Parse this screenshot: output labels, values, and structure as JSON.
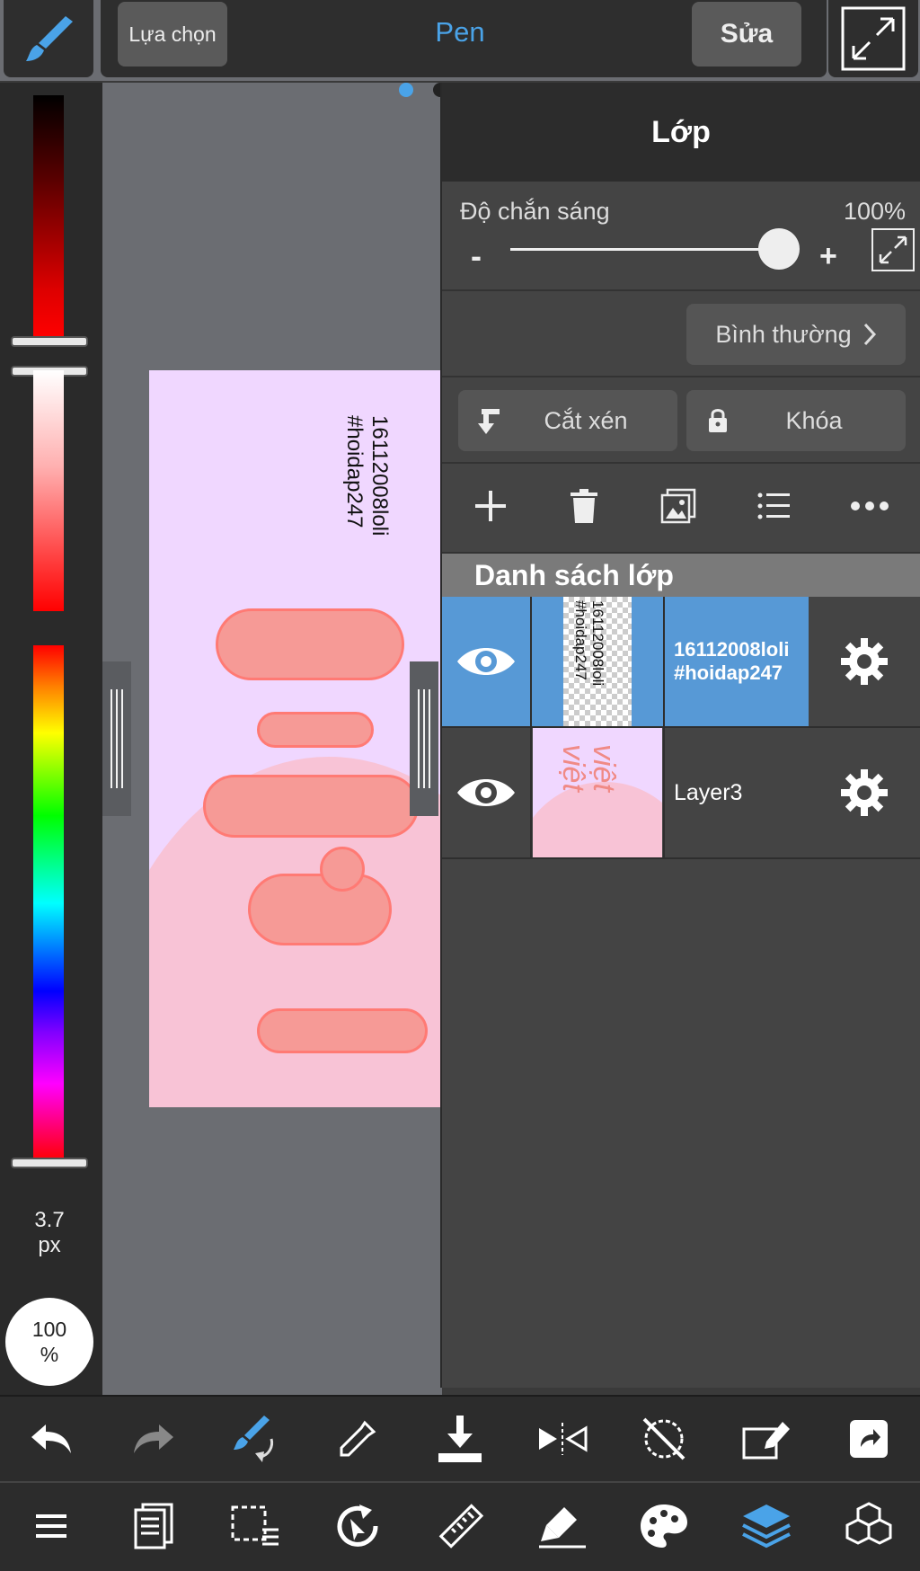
{
  "topbar": {
    "select_label": "Lựa chọn",
    "pen_title": "Pen",
    "edit_label": "Sửa"
  },
  "left_panel": {
    "brush_size_value": "3.7",
    "brush_size_unit": "px",
    "opacity_value": "100",
    "opacity_unit": "%"
  },
  "artwork": {
    "text_lines": "16112008loli\n#hoidap247"
  },
  "layer_panel": {
    "title": "Lớp",
    "opacity_label": "Độ chắn sáng",
    "opacity_value": "100%",
    "opacity_level": 1.0,
    "minus": "-",
    "plus": "+",
    "blend_mode": "Bình thường",
    "clip_label": "Cắt xén",
    "lock_label": "Khóa",
    "list_header": "Danh sách lớp",
    "layers": [
      {
        "name_line1": "16112008loli",
        "name_line2": "#hoidap247",
        "thumb_text": "16112008loli\n#hoidap247",
        "selected": true
      },
      {
        "name": "Layer3",
        "thumb_text": "việt\nviệt",
        "selected": false
      }
    ]
  },
  "colors": {
    "accent": "#4aa3e8",
    "selected_layer": "#5799d6",
    "panel_bg": "#444444",
    "canvas_bg": "#6b6d72",
    "art_bg": "#f0d7ff",
    "art_hill": "#f8c3d6",
    "art_stroke": "#f69a96"
  },
  "icons": {
    "top": [
      "brush-icon",
      "fullscreen-icon"
    ],
    "toolbar_row1": [
      "undo-icon",
      "redo-icon",
      "brush-rotate-icon",
      "eyedropper-icon",
      "save-download-icon",
      "flip-icon",
      "rotate-off-icon",
      "transform-icon",
      "share-icon"
    ],
    "toolbar_row2": [
      "menu-icon",
      "pages-icon",
      "selection-icon",
      "transform-rotate-icon",
      "ruler-icon",
      "fill-icon",
      "palette-icon",
      "layers-icon",
      "materials-icon"
    ]
  }
}
